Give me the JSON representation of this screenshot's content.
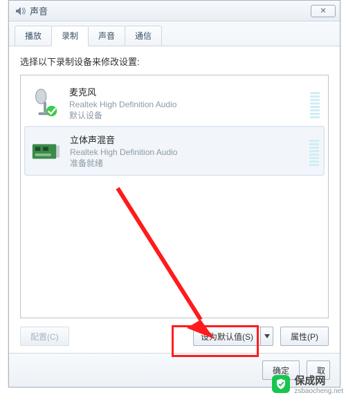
{
  "window": {
    "title": "声音",
    "close_glyph": "✕"
  },
  "tabs": [
    {
      "label": "播放",
      "active": false
    },
    {
      "label": "录制",
      "active": true
    },
    {
      "label": "声音",
      "active": false
    },
    {
      "label": "通信",
      "active": false
    }
  ],
  "instruction": "选择以下录制设备来修改设置:",
  "devices": [
    {
      "name": "麦克风",
      "desc": "Realtek High Definition Audio",
      "status": "默认设备",
      "selected": false,
      "kind": "mic",
      "checkmark": true
    },
    {
      "name": "立体声混音",
      "desc": "Realtek High Definition Audio",
      "status": "准备就绪",
      "selected": true,
      "kind": "card",
      "checkmark": false
    }
  ],
  "buttons": {
    "configure": "配置(C)",
    "set_default": "设为默认值(S)",
    "properties": "属性(P)",
    "ok": "确定",
    "cancel": "取"
  },
  "watermark": {
    "brand": "保成网",
    "url": "zsbaocheng.net"
  },
  "colors": {
    "highlight": "#ff1b1b",
    "wm_green": "#18c54e"
  }
}
